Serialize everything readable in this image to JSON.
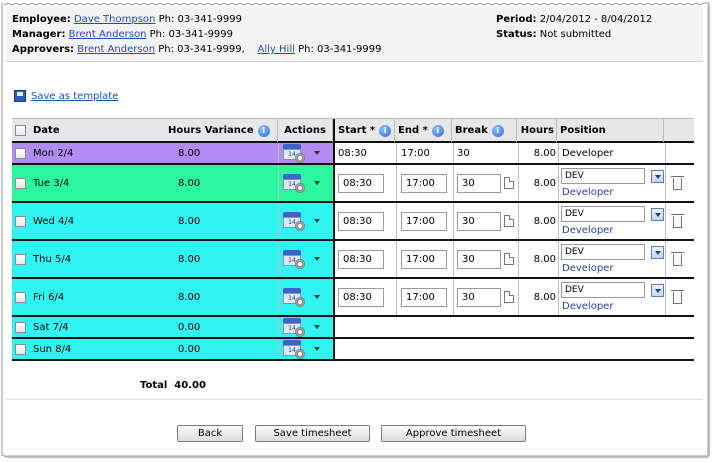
{
  "header": {
    "employee_label": "Employee:",
    "employee_name": "Dave Thompson",
    "employee_phone": "Ph: 03-341-9999",
    "manager_label": "Manager:",
    "manager_name": "Brent Anderson",
    "manager_phone": "Ph: 03-341-9999",
    "approvers_label": "Approvers:",
    "approver1_name": "Brent Anderson",
    "approver1_phone": "Ph: 03-341-9999,",
    "approver2_name": "Ally Hill",
    "approver2_phone": "Ph: 03-341-9999",
    "period_label": "Period:",
    "period_value": "2/04/2012 - 8/04/2012",
    "status_label": "Status:",
    "status_value": "Not submitted"
  },
  "save_template": "Save as template",
  "columns": {
    "date": "Date",
    "hours_variance": "Hours Variance",
    "actions": "Actions",
    "start": "Start *",
    "end": "End *",
    "break": "Break",
    "hours": "Hours",
    "position": "Position"
  },
  "rows": [
    {
      "date": "Mon 2/4",
      "variance": "8.00",
      "start": "08:30",
      "end": "17:00",
      "break": "30",
      "hours": "8.00",
      "position": "Developer",
      "editable": false,
      "color": "#b18cf4"
    },
    {
      "date": "Tue 3/4",
      "variance": "8.00",
      "start": "08:30",
      "end": "17:00",
      "break": "30",
      "hours": "8.00",
      "position_code": "DEV",
      "position": "Developer",
      "editable": true,
      "color": "#2bf7a1"
    },
    {
      "date": "Wed 4/4",
      "variance": "8.00",
      "start": "08:30",
      "end": "17:00",
      "break": "30",
      "hours": "8.00",
      "position_code": "DEV",
      "position": "Developer",
      "editable": true,
      "color": "#2ff4f2"
    },
    {
      "date": "Thu 5/4",
      "variance": "8.00",
      "start": "08:30",
      "end": "17:00",
      "break": "30",
      "hours": "8.00",
      "position_code": "DEV",
      "position": "Developer",
      "editable": true,
      "color": "#2ff4f2"
    },
    {
      "date": "Fri 6/4",
      "variance": "8.00",
      "start": "08:30",
      "end": "17:00",
      "break": "30",
      "hours": "8.00",
      "position_code": "DEV",
      "position": "Developer",
      "editable": true,
      "color": "#2ff4f2"
    },
    {
      "date": "Sat 7/4",
      "variance": "0.00",
      "editable": false,
      "color": "#2ff4f2"
    },
    {
      "date": "Sun 8/4",
      "variance": "0.00",
      "editable": false,
      "color": "#2ff4f2"
    }
  ],
  "total_label": "Total",
  "total_value": "40.00",
  "buttons": {
    "back": "Back",
    "save": "Save timesheet",
    "approve": "Approve timesheet"
  },
  "icons": {
    "info": "info-icon",
    "calendar": "calendar-gear-icon",
    "note": "note-icon",
    "delete": "trash-icon"
  }
}
